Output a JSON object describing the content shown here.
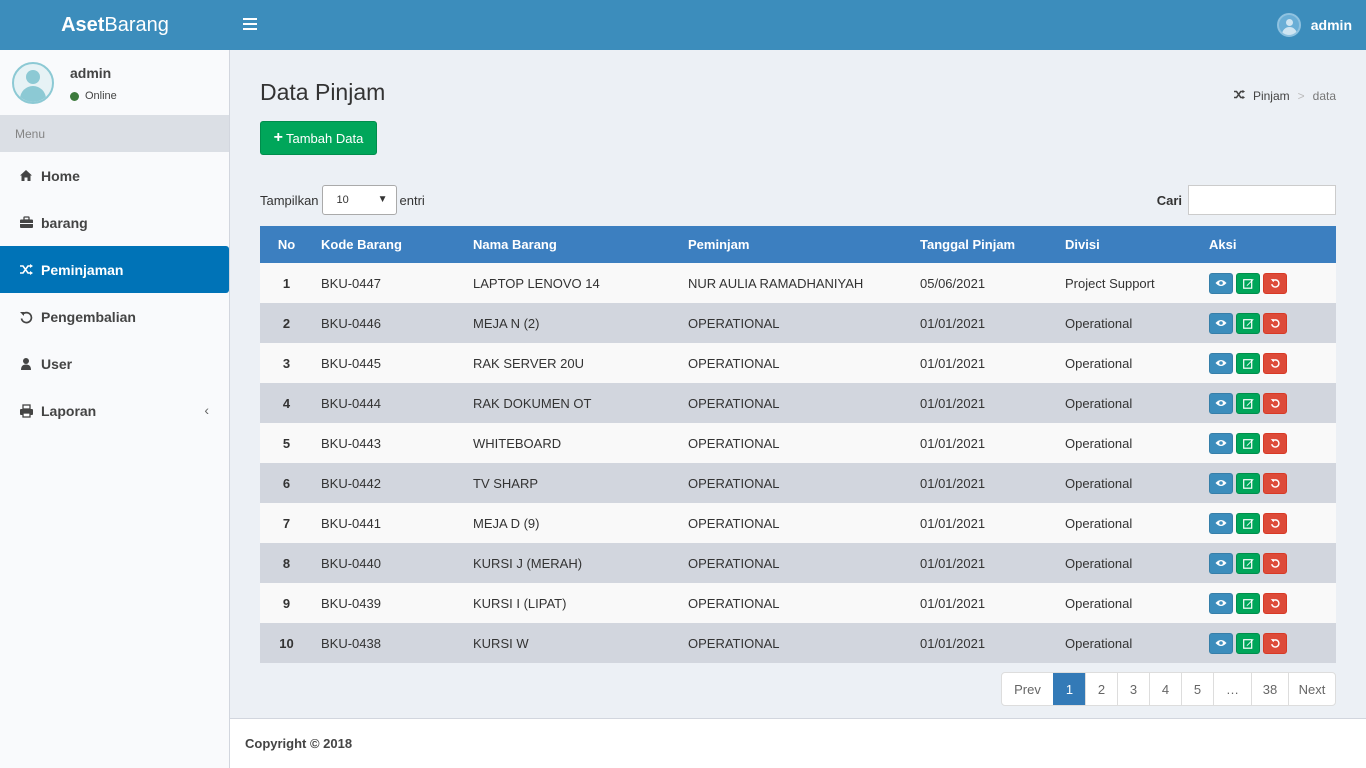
{
  "header": {
    "logo_bold": "Aset",
    "logo_rest": "Barang",
    "username": "admin"
  },
  "sidebar": {
    "user": {
      "name": "admin",
      "status": "Online"
    },
    "menu_header": "Menu",
    "items": [
      {
        "label": "Home",
        "icon": "home-icon"
      },
      {
        "label": "barang",
        "icon": "briefcase-icon"
      },
      {
        "label": "Peminjaman",
        "icon": "shuffle-icon",
        "active": true
      },
      {
        "label": "Pengembalian",
        "icon": "undo-icon"
      },
      {
        "label": "User",
        "icon": "user-icon"
      },
      {
        "label": "Laporan",
        "icon": "print-icon"
      }
    ]
  },
  "main": {
    "title": "Data Pinjam",
    "breadcrumb": {
      "parent": "Pinjam",
      "current": "data"
    },
    "add_button": "Tambah Data",
    "length": {
      "before": "Tampilkan",
      "value": "10",
      "after": "entri"
    },
    "search": {
      "label": "Cari",
      "value": ""
    },
    "table": {
      "headers": [
        "No",
        "Kode Barang",
        "Nama Barang",
        "Peminjam",
        "Tanggal Pinjam",
        "Divisi",
        "Aksi"
      ],
      "rows": [
        [
          "1",
          "BKU-0447",
          "LAPTOP LENOVO 14",
          "NUR AULIA RAMADHANIYAH",
          "05/06/2021",
          "Project Support"
        ],
        [
          "2",
          "BKU-0446",
          "MEJA N (2)",
          "OPERATIONAL",
          "01/01/2021",
          "Operational"
        ],
        [
          "3",
          "BKU-0445",
          "RAK SERVER 20U",
          "OPERATIONAL",
          "01/01/2021",
          "Operational"
        ],
        [
          "4",
          "BKU-0444",
          "RAK DOKUMEN OT",
          "OPERATIONAL",
          "01/01/2021",
          "Operational"
        ],
        [
          "5",
          "BKU-0443",
          "WHITEBOARD",
          "OPERATIONAL",
          "01/01/2021",
          "Operational"
        ],
        [
          "6",
          "BKU-0442",
          "TV SHARP",
          "OPERATIONAL",
          "01/01/2021",
          "Operational"
        ],
        [
          "7",
          "BKU-0441",
          "MEJA D (9)",
          "OPERATIONAL",
          "01/01/2021",
          "Operational"
        ],
        [
          "8",
          "BKU-0440",
          "KURSI J (MERAH)",
          "OPERATIONAL",
          "01/01/2021",
          "Operational"
        ],
        [
          "9",
          "BKU-0439",
          "KURSI I (LIPAT)",
          "OPERATIONAL",
          "01/01/2021",
          "Operational"
        ],
        [
          "10",
          "BKU-0438",
          "KURSI W",
          "OPERATIONAL",
          "01/01/2021",
          "Operational"
        ]
      ]
    },
    "pagination": [
      "Prev",
      "1",
      "2",
      "3",
      "4",
      "5",
      "…",
      "38",
      "Next"
    ],
    "pagination_active": "1"
  },
  "footer": {
    "text": "Copyright © 2018"
  },
  "colors": {
    "header": "#3c8dbc",
    "active_nav": "#0073b7",
    "table_head": "#3c7fc0",
    "success": "#00a65a",
    "danger": "#dd4b39"
  }
}
